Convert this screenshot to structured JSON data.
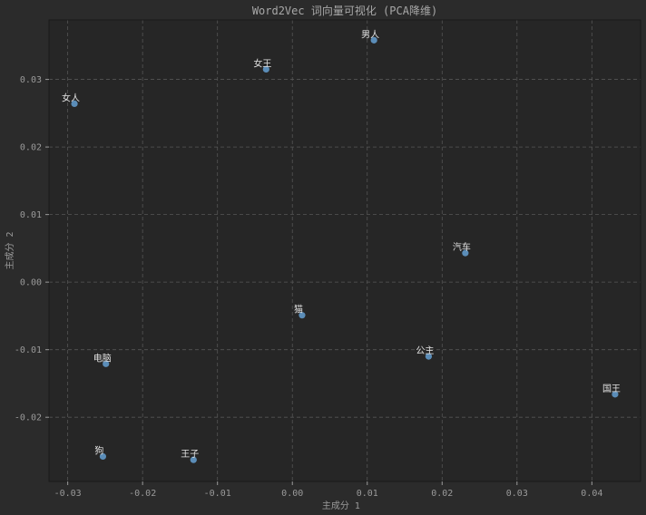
{
  "chart_data": {
    "type": "scatter",
    "title": "Word2Vec 词向量可视化 (PCA降维)",
    "xlabel": "主成分 1",
    "ylabel": "主成分 2",
    "xlim": [
      -0.0325,
      0.0465
    ],
    "ylim": [
      -0.0295,
      0.0388
    ],
    "xticks": [
      -0.03,
      -0.02,
      -0.01,
      0.0,
      0.01,
      0.02,
      0.03,
      0.04
    ],
    "xtick_labels": [
      "-0.03",
      "-0.02",
      "-0.01",
      "0.00",
      "0.01",
      "0.02",
      "0.03",
      "0.04"
    ],
    "yticks": [
      -0.02,
      -0.01,
      0.0,
      0.01,
      0.02,
      0.03
    ],
    "ytick_labels": [
      "-0.02",
      "-0.01",
      "0.00",
      "0.01",
      "0.02",
      "0.03"
    ],
    "grid": true,
    "colors": {
      "background": "#2b2b2b",
      "plot_area": "#262626",
      "marker": "#5b8db8",
      "grid": "#555555",
      "text": "#9a9a9a",
      "point_label": "#e0e0e0"
    },
    "points": [
      {
        "label": "男人",
        "x": 0.0109,
        "y": 0.0358
      },
      {
        "label": "女王",
        "x": -0.0035,
        "y": 0.0315
      },
      {
        "label": "女人",
        "x": -0.0291,
        "y": 0.0264
      },
      {
        "label": "汽车",
        "x": 0.0231,
        "y": 0.0043
      },
      {
        "label": "猫",
        "x": 0.0013,
        "y": -0.0049
      },
      {
        "label": "公主",
        "x": 0.0182,
        "y": -0.011
      },
      {
        "label": "电脑",
        "x": -0.0249,
        "y": -0.0121
      },
      {
        "label": "国王",
        "x": 0.0431,
        "y": -0.0166
      },
      {
        "label": "狗",
        "x": -0.0253,
        "y": -0.0258
      },
      {
        "label": "王子",
        "x": -0.0132,
        "y": -0.0263
      }
    ]
  }
}
